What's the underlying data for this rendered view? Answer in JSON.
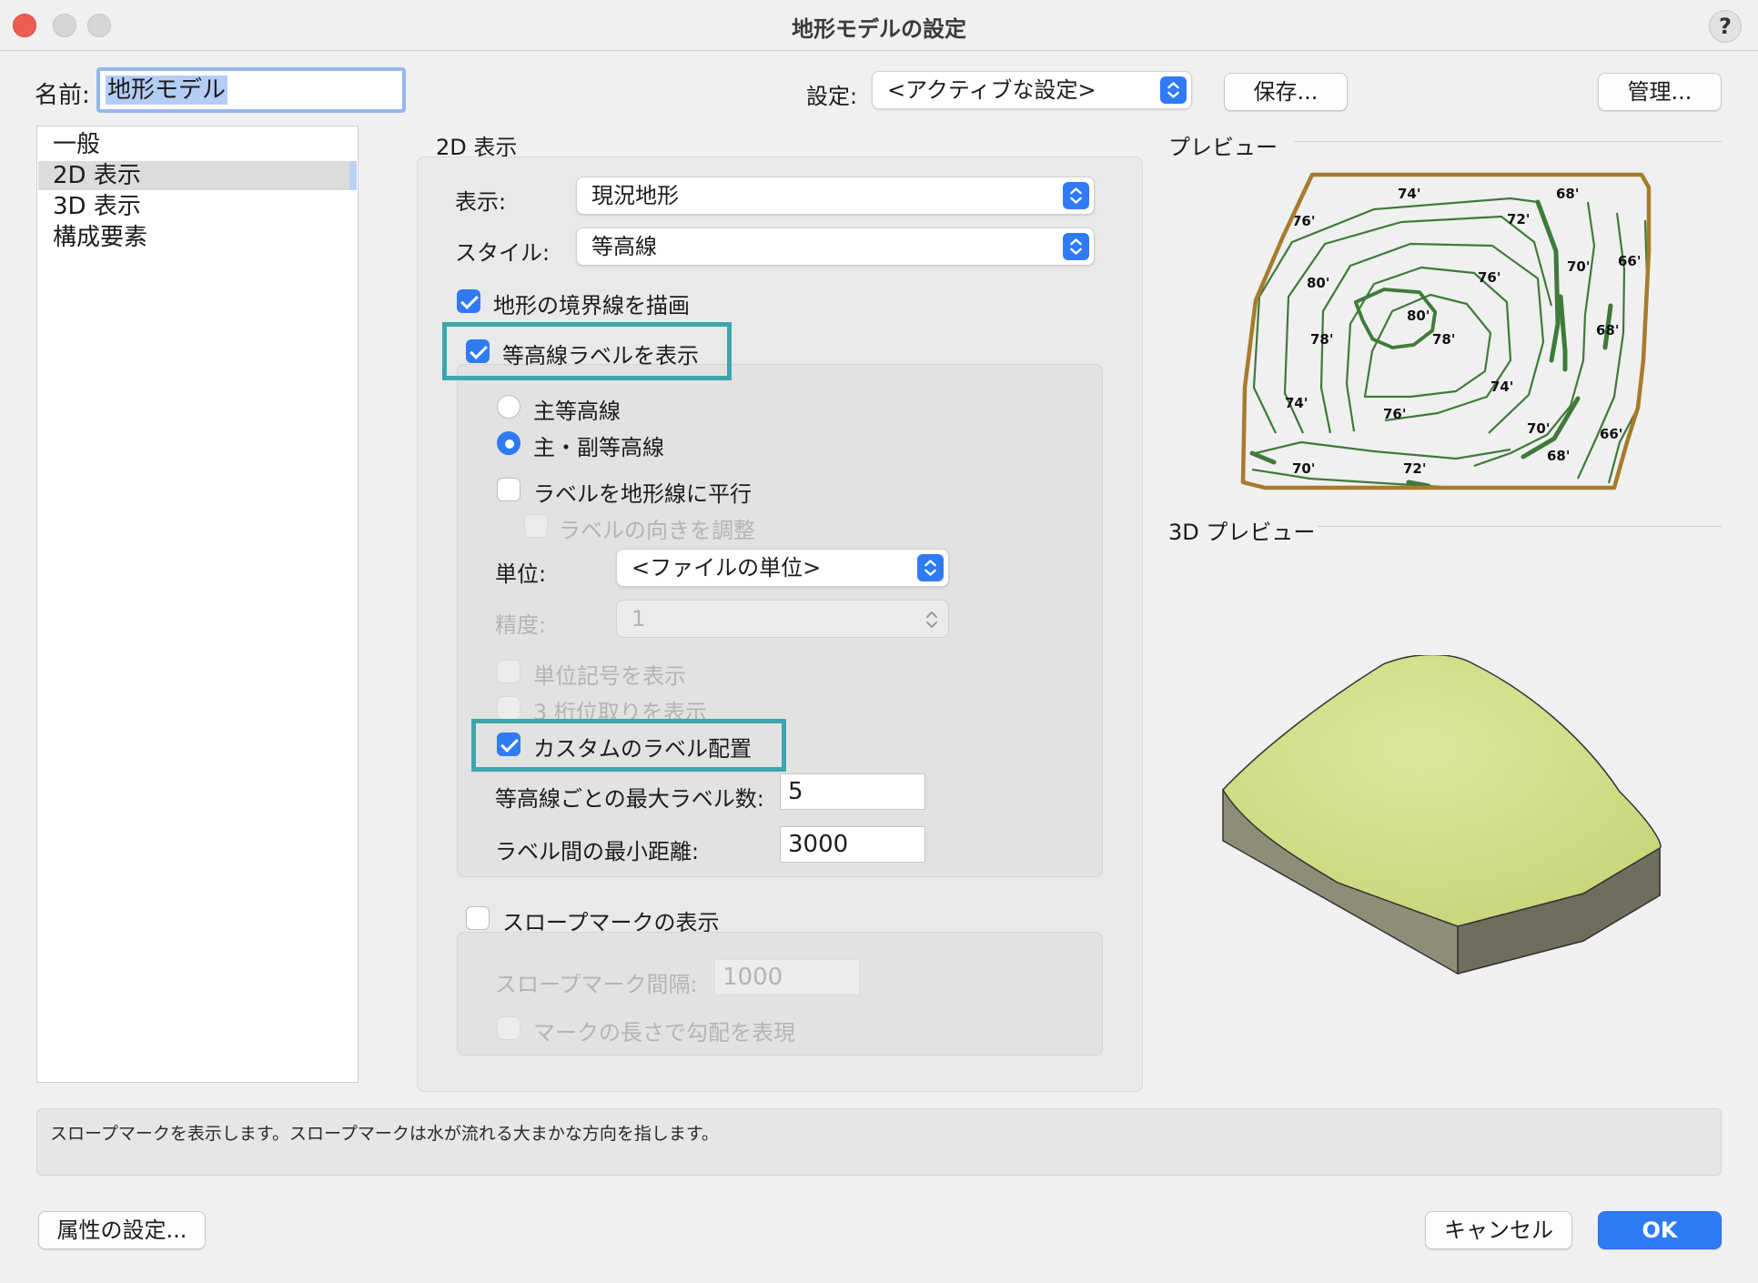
{
  "window": {
    "title": "地形モデルの設定",
    "help": "?"
  },
  "header": {
    "name_label": "名前:",
    "name_value": "地形モデル",
    "settings_label": "設定:",
    "settings_value": "<アクティブな設定>",
    "save_button": "保存...",
    "manage_button": "管理..."
  },
  "sidebar": {
    "items": [
      {
        "label": "一般"
      },
      {
        "label": "2D 表示"
      },
      {
        "label": "3D 表示"
      },
      {
        "label": "構成要素"
      }
    ]
  },
  "panel": {
    "title": "2D 表示",
    "display_label": "表示:",
    "display_value": "現況地形",
    "style_label": "スタイル:",
    "style_value": "等高線",
    "draw_boundary": "地形の境界線を描画",
    "show_contour_labels": "等高線ラベルを表示",
    "radio_major": "主等高線",
    "radio_major_minor": "主・副等高線",
    "parallel_labels": "ラベルを地形線に平行",
    "adjust_direction": "ラベルの向きを調整",
    "units_label": "単位:",
    "units_value": "<ファイルの単位>",
    "precision_label": "精度:",
    "precision_value": "1",
    "show_unit_mark": "単位記号を表示",
    "show_thousands": "3 桁位取りを表示",
    "custom_placement": "カスタムのラベル配置",
    "max_labels_label": "等高線ごとの最大ラベル数:",
    "max_labels_value": "5",
    "min_distance_label": "ラベル間の最小距離:",
    "min_distance_value": "3000",
    "slope_marks": "スロープマークの表示",
    "slope_interval_label": "スロープマーク間隔:",
    "slope_interval_value": "1000",
    "slope_length": "マークの長さで勾配を表現"
  },
  "preview": {
    "title": "プレビュー",
    "title_3d": "3D プレビュー",
    "labels": [
      "74'",
      "68'",
      "76'",
      "72'",
      "66'",
      "70'",
      "80'",
      "76'",
      "80'",
      "68'",
      "78'",
      "78'",
      "74'",
      "74'",
      "76'",
      "70'",
      "66'",
      "68'",
      "70'",
      "72'"
    ]
  },
  "status_text": "スロープマークを表示します。スロープマークは水が流れる大まかな方向を指します。",
  "footer": {
    "attributes_button": "属性の設定...",
    "cancel_button": "キャンセル",
    "ok_button": "OK"
  },
  "colors": {
    "accent": "#2f7bf5",
    "highlight": "#3da5ad",
    "contour": "#3f7a3a",
    "boundary": "#a67c2c",
    "terrain_top": "#d2e08b",
    "terrain_side": "#8a8a72"
  }
}
